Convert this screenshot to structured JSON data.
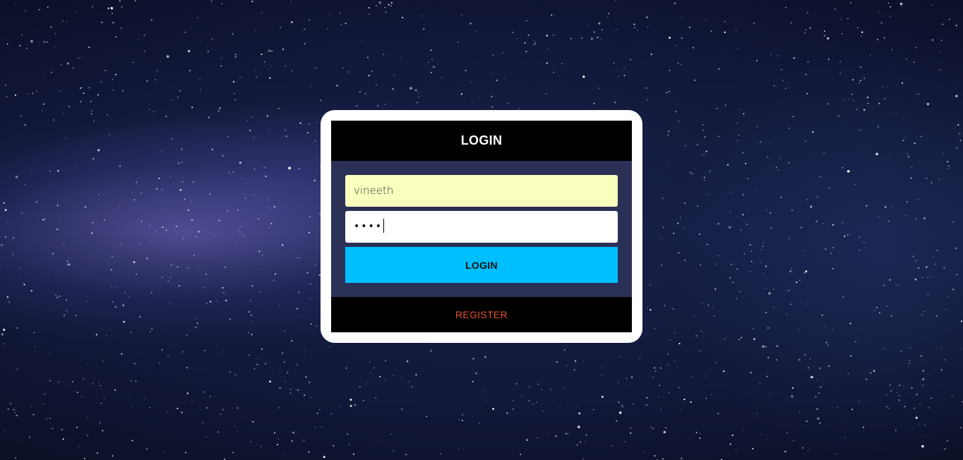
{
  "login_card": {
    "title": "LOGIN",
    "username_value": "vineeth",
    "password_masked": "••••",
    "login_button_label": "LOGIN",
    "register_link_label": "REGISTER"
  },
  "colors": {
    "header_bg": "#000000",
    "body_bg": "#2b3057",
    "username_bg": "#f9ffbd",
    "login_button_bg": "#00bfff",
    "register_link": "#e5532e"
  }
}
